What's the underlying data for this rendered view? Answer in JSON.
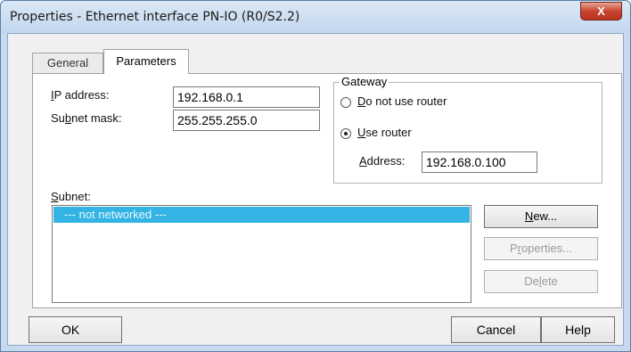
{
  "window": {
    "title": "Properties - Ethernet interface  PN-IO (R0/S2.2)",
    "close_glyph": "X"
  },
  "tabs": [
    {
      "label": "General",
      "active": false
    },
    {
      "label": "Parameters",
      "active": true
    }
  ],
  "ip": {
    "label_first": "I",
    "label_rest": "P address:",
    "value": "192.168.0.1"
  },
  "subnet_mask": {
    "label_before": "Su",
    "label_underlined": "b",
    "label_after": "net mask:",
    "value": "255.255.255.0"
  },
  "gateway": {
    "title": "Gateway",
    "do_not_use": {
      "underlined": "D",
      "rest": "o not use router",
      "checked": false
    },
    "use_router": {
      "underlined": "U",
      "rest": "se router",
      "checked": true
    },
    "address_label_underlined": "A",
    "address_label_rest": "ddress:",
    "address_value": "192.168.0.100"
  },
  "subnet_section": {
    "label_underlined": "S",
    "label_rest": "ubnet:",
    "items": [
      "--- not networked ---"
    ],
    "selected_index": 0
  },
  "side_buttons": {
    "new_underlined": "N",
    "new_rest": "ew...",
    "properties_before": "P",
    "properties_underlined": "r",
    "properties_after": "operties...",
    "delete_before": "De",
    "delete_underlined": "l",
    "delete_after": "ete"
  },
  "footer": {
    "ok": "OK",
    "cancel": "Cancel",
    "help": "Help"
  },
  "colors": {
    "selection": "#34b4e4",
    "frame": "#c6d9ef",
    "close": "#c7452f"
  }
}
